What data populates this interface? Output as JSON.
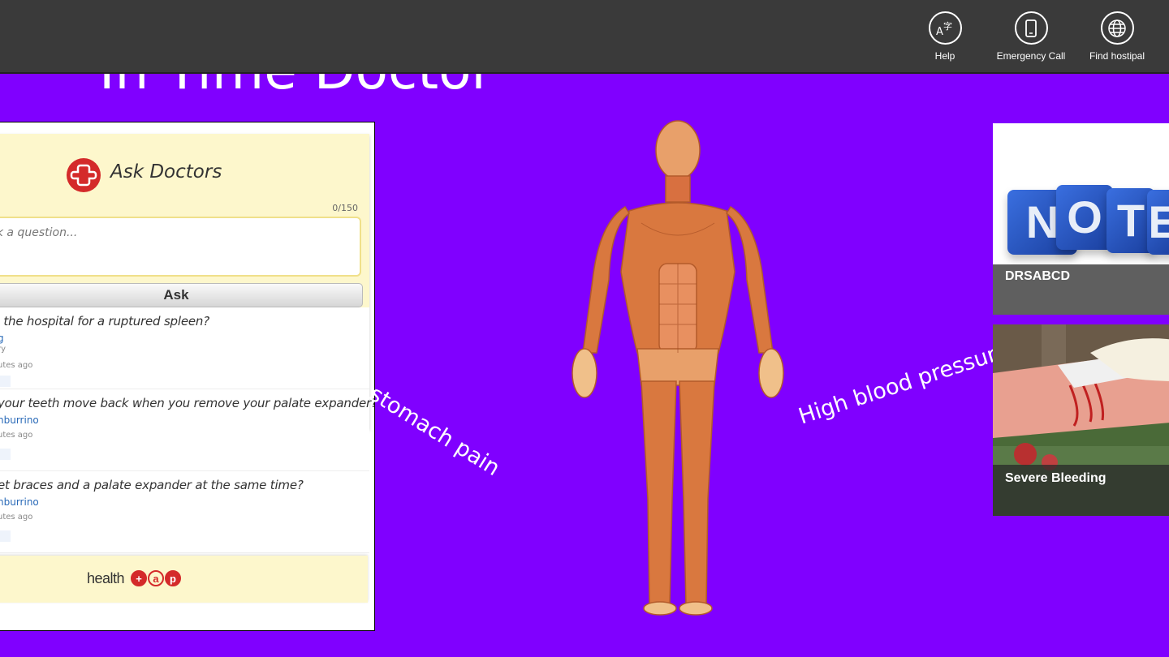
{
  "app": {
    "title": "In Time Doctor"
  },
  "appbar": {
    "buttons": [
      {
        "label": "Help",
        "icon": "translate-icon"
      },
      {
        "label": "Emergency Call",
        "icon": "phone-icon"
      },
      {
        "label": "Find hostipal",
        "icon": "globe-icon"
      }
    ]
  },
  "ask": {
    "title": "Ask Doctors",
    "counter": "0/150",
    "input_placeholder": "Ask a question...",
    "ask_label": "Ask",
    "questions": [
      {
        "text": "How long will I have to stay in the hospital for a ruptured spleen?",
        "user": "g",
        "category": "ry",
        "time": "utes ago"
      },
      {
        "text": "your teeth move back when you remove your palate expander?",
        "user": "nburrino",
        "time": "utes ago"
      },
      {
        "text": "et braces and a palate expander at the same time?",
        "user": "nburrino",
        "time": "utes ago"
      }
    ],
    "footer_brand": "health",
    "footer_letters": [
      "+",
      "a",
      "p"
    ]
  },
  "symptoms": {
    "left": "stomach pain",
    "right": "High blood pressure"
  },
  "tiles": [
    {
      "label": "DRSABCD",
      "cube_letters": [
        "N",
        "O",
        "T",
        "E"
      ]
    },
    {
      "label": "Severe Bleeding"
    }
  ],
  "colors": {
    "background": "#8000ff",
    "appbar": "#3a3a3a",
    "accent_red": "#d42a2a"
  }
}
